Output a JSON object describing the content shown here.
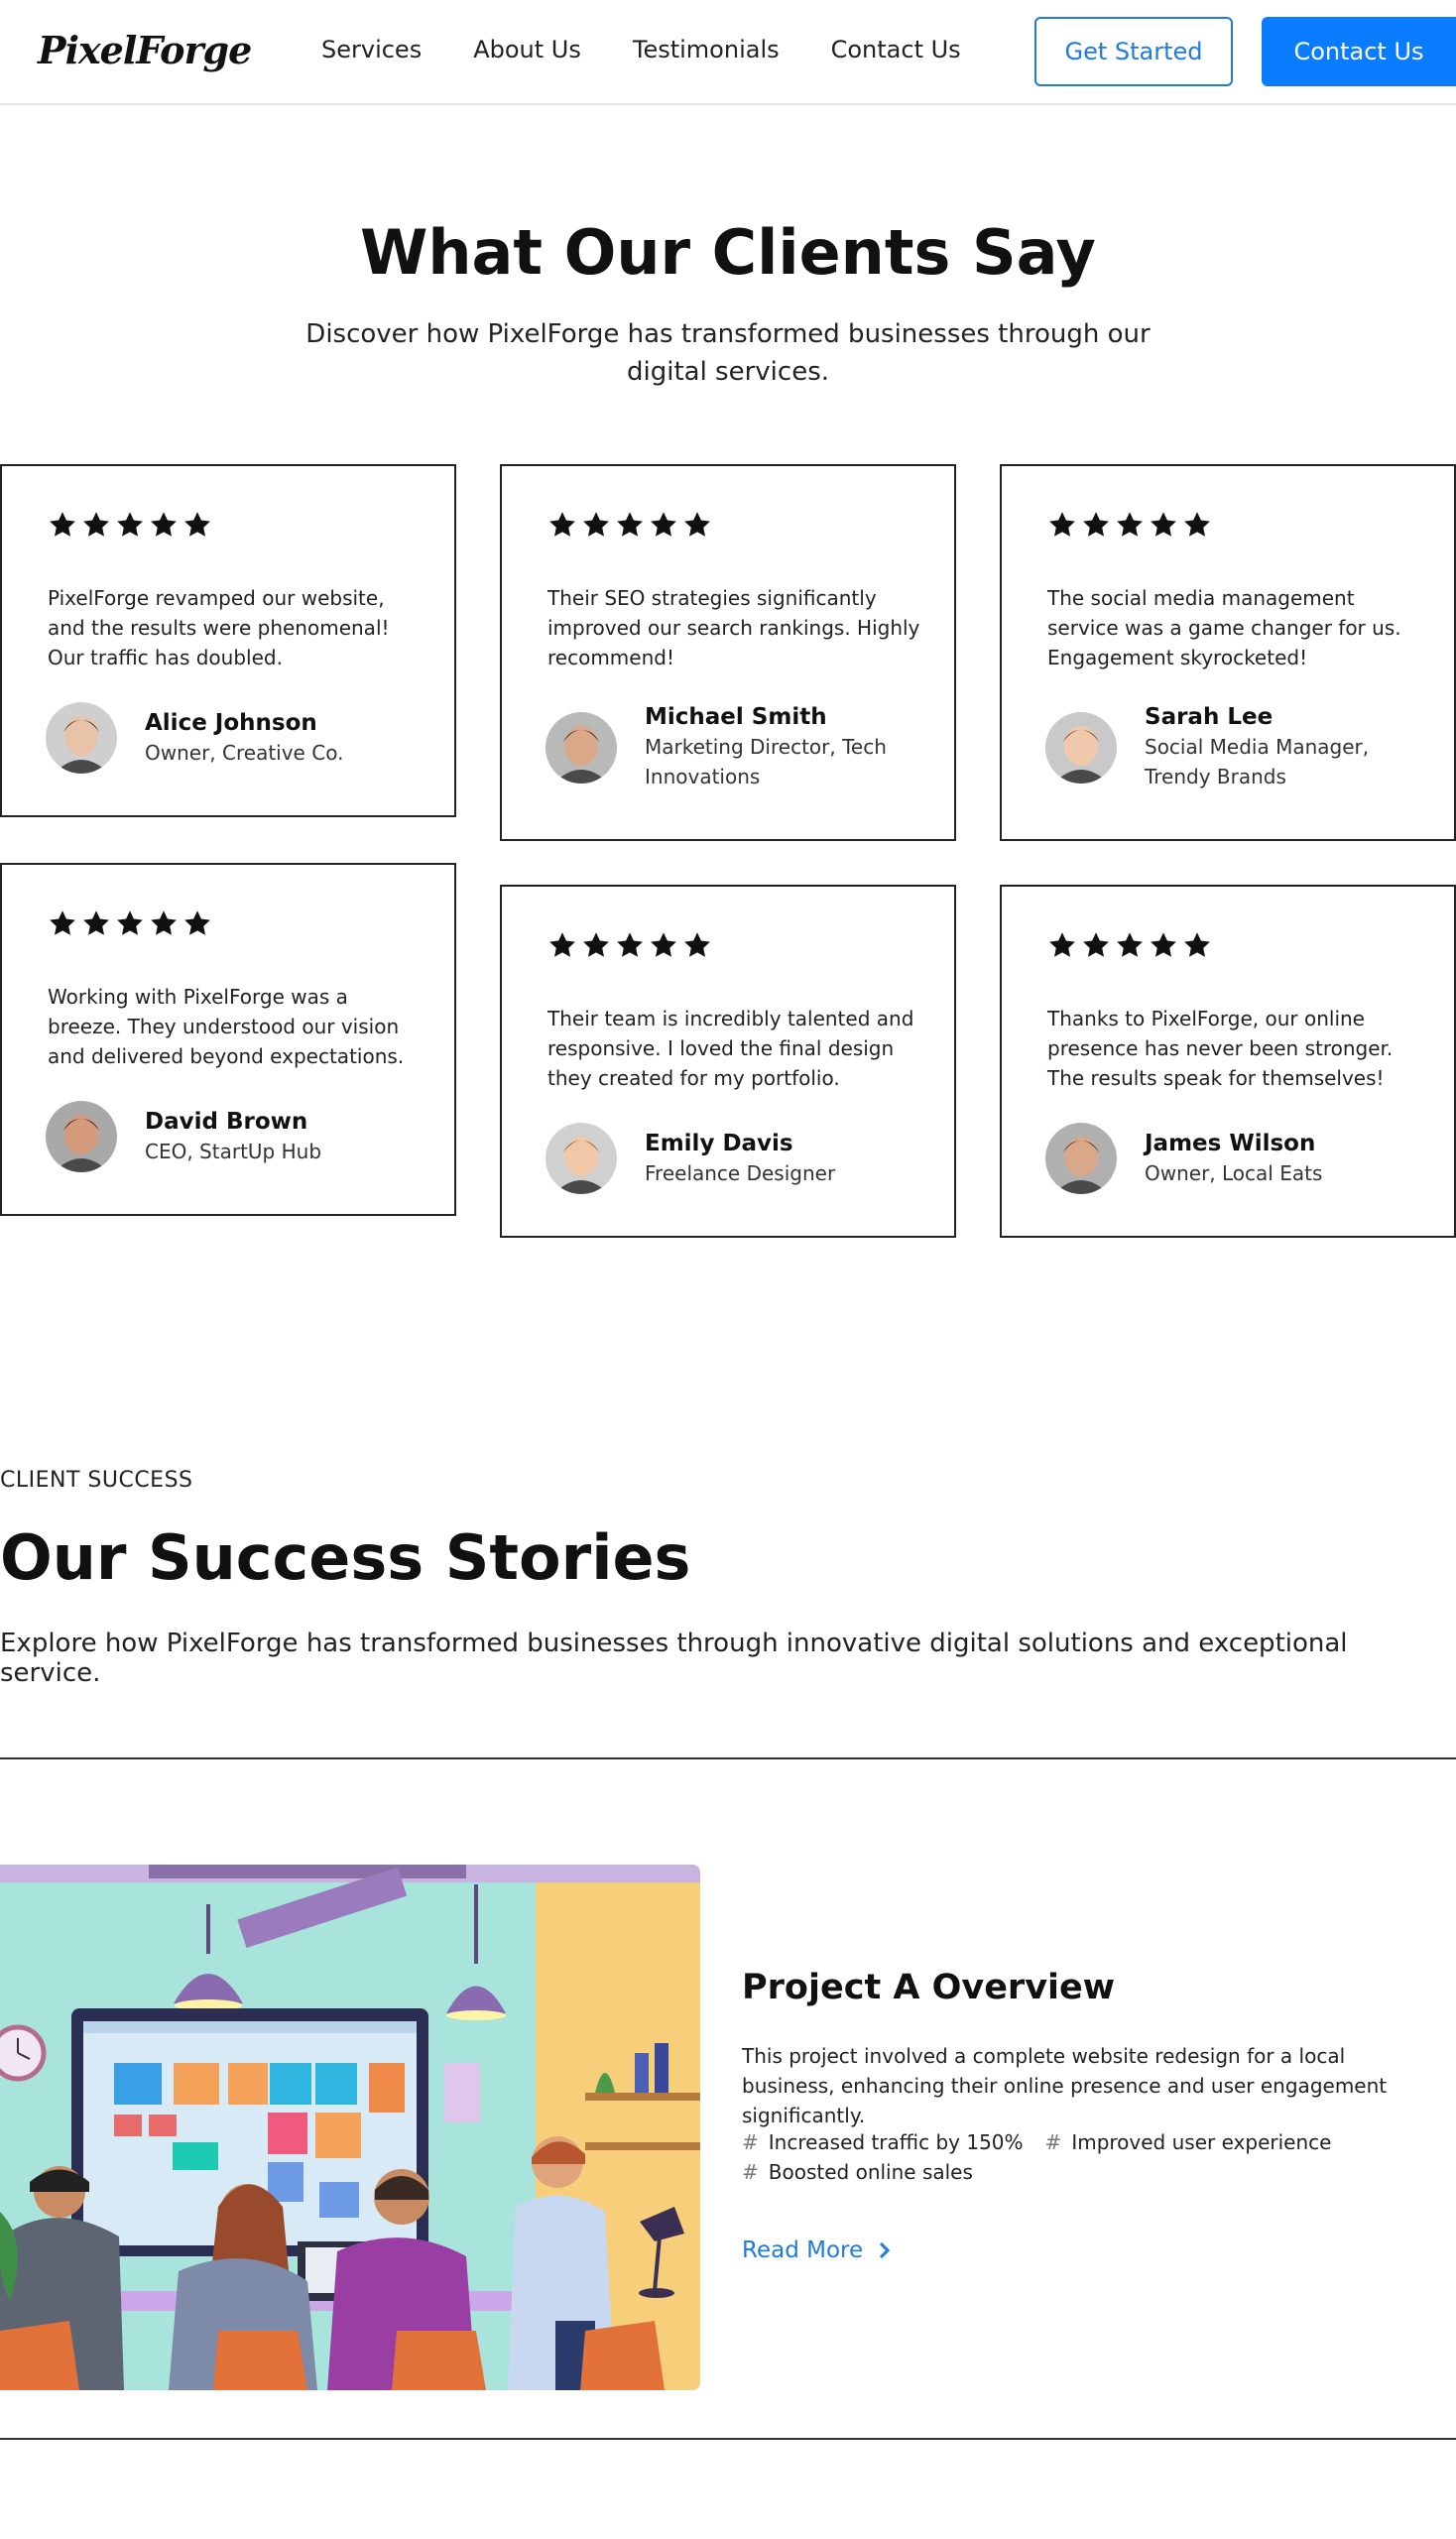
{
  "nav": {
    "logo": "PixelForge",
    "links": [
      "Services",
      "About Us",
      "Testimonials",
      "Contact Us"
    ],
    "cta_outline": "Get Started",
    "cta_primary": "Contact Us"
  },
  "testimonials": {
    "title": "What Our Clients Say",
    "subtitle": "Discover how PixelForge has transformed businesses through our digital services.",
    "items": [
      {
        "rating": 5,
        "quote": "PixelForge revamped our website, and the results were phenomenal! Our traffic has doubled.",
        "name": "Alice Johnson",
        "role": "Owner, Creative Co.",
        "avatar_icon": "person-avatar-icon"
      },
      {
        "rating": 5,
        "quote": "Their SEO strategies significantly improved our search rankings. Highly recommend!",
        "name": "Michael Smith",
        "role": "Marketing Director, Tech Innovations",
        "avatar_icon": "person-avatar-icon"
      },
      {
        "rating": 5,
        "quote": "The social media management service was a game changer for us. Engagement skyrocketed!",
        "name": "Sarah Lee",
        "role": "Social Media Manager, Trendy Brands",
        "avatar_icon": "person-avatar-icon"
      },
      {
        "rating": 5,
        "quote": "Working with PixelForge was a breeze. They understood our vision and delivered beyond expectations.",
        "name": "David Brown",
        "role": "CEO, StartUp Hub",
        "avatar_icon": "person-avatar-icon"
      },
      {
        "rating": 5,
        "quote": "Their team is incredibly talented and responsive. I loved the final design they created for my portfolio.",
        "name": "Emily Davis",
        "role": "Freelance Designer",
        "avatar_icon": "person-avatar-icon"
      },
      {
        "rating": 5,
        "quote": "Thanks to PixelForge, our online presence has never been stronger. The results speak for themselves!",
        "name": "James Wilson",
        "role": "Owner, Local Eats",
        "avatar_icon": "person-avatar-icon"
      }
    ]
  },
  "success": {
    "eyebrow": "CLIENT SUCCESS",
    "title": "Our Success Stories",
    "subtitle": "Explore how PixelForge has transformed businesses through innovative digital solutions and exceptional service.",
    "project": {
      "title": "Project A Overview",
      "description": "This project involved a complete website redesign for a local business, enhancing their online presence and user engagement significantly.",
      "tags": [
        "Increased traffic by 150%",
        "Improved user experience",
        "Boosted online sales"
      ],
      "read_more": "Read More",
      "image_icon": "team-meeting-illustration"
    }
  },
  "colors": {
    "accent": "#0a7cff",
    "link": "#1f7ae0",
    "text": "#111111",
    "border": "#222222"
  }
}
